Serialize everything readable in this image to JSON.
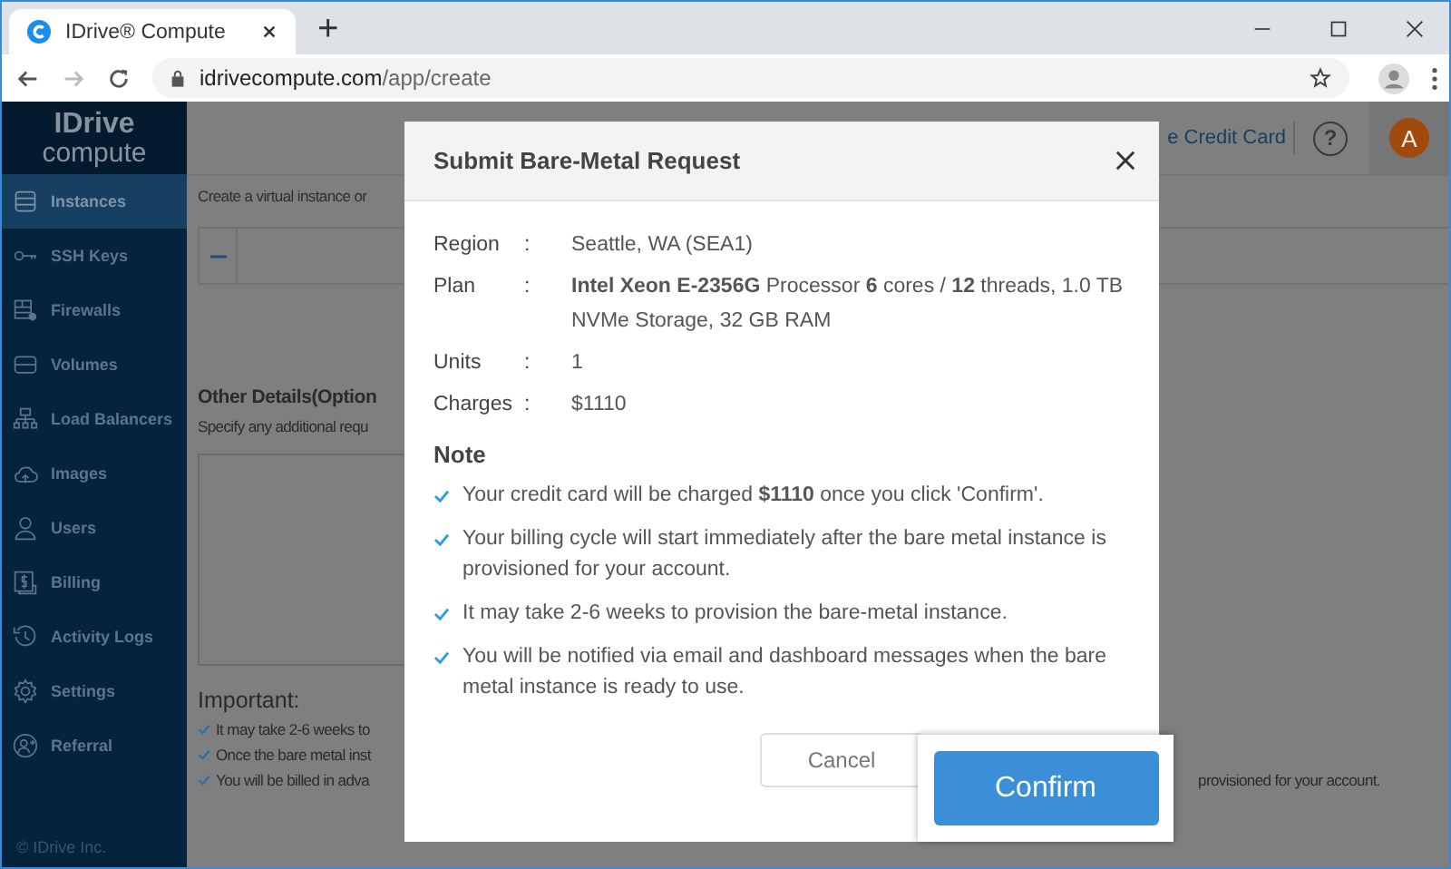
{
  "browser": {
    "tab_title": "IDrive® Compute",
    "new_tab": "+",
    "url_host": "idrivecompute.com",
    "url_path": "/app/create"
  },
  "app": {
    "logo": {
      "brand": "IDrive",
      "sub": "compute"
    },
    "sidebar": {
      "items": [
        {
          "label": "Instances",
          "selected": true
        },
        {
          "label": "SSH Keys",
          "selected": false
        },
        {
          "label": "Firewalls",
          "selected": false
        },
        {
          "label": "Volumes",
          "selected": false
        },
        {
          "label": "Load Balancers",
          "selected": false
        },
        {
          "label": "Images",
          "selected": false
        },
        {
          "label": "Users",
          "selected": false
        },
        {
          "label": "Billing",
          "selected": false
        },
        {
          "label": "Activity Logs",
          "selected": false
        },
        {
          "label": "Settings",
          "selected": false
        },
        {
          "label": "Referral",
          "selected": false
        }
      ],
      "footer": "© IDrive Inc."
    },
    "header": {
      "link": "e Credit Card",
      "help": "?",
      "avatar": "A"
    },
    "content": {
      "intro": "Create a virtual instance or",
      "section_title": "Other Details(Option",
      "section_hint": "Specify any additional requ",
      "important_title": "Important:",
      "important_items": [
        "It may take 2-6 weeks to",
        "Once the bare metal inst",
        "You will be billed in adva"
      ],
      "trailing_text": "provisioned for your account."
    }
  },
  "modal": {
    "title": "Submit Bare-Metal Request",
    "details": [
      {
        "label": "Region",
        "value": "Seattle, WA (SEA1)"
      },
      {
        "label": "Plan",
        "value": "**Intel Xeon E-2356G** Processor **6** cores / **12** threads, 1.0 TB NVMe Storage, 32 GB RAM"
      },
      {
        "label": "Units",
        "value": "1"
      },
      {
        "label": "Charges",
        "value": "$1110"
      }
    ],
    "separator": ":",
    "note_title": "Note",
    "notes": [
      "Your credit card will be charged **$1110** once you click 'Confirm'.",
      "Your billing cycle will start immediately after the bare metal instance is provisioned for your account.",
      "It may take 2-6 weeks to provision the bare-metal instance.",
      "You will be notified via email and dashboard messages when the bare metal instance is ready to use."
    ],
    "cancel": "Cancel",
    "confirm": "Confirm"
  }
}
